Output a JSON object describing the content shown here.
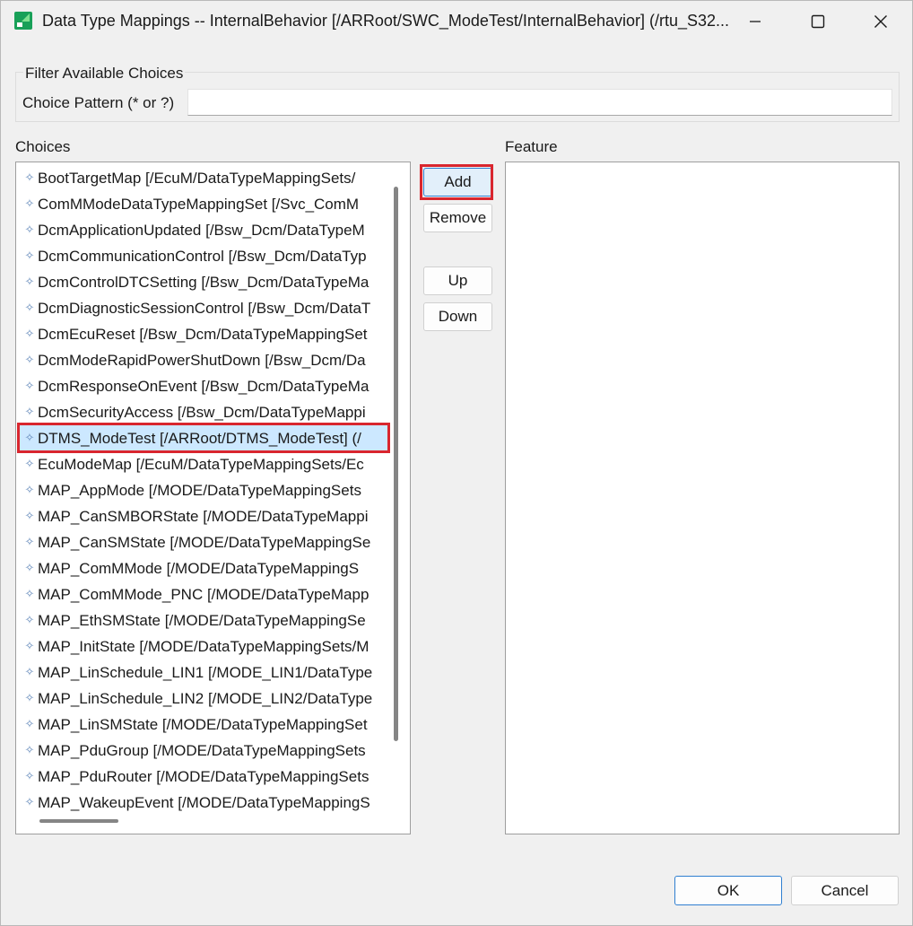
{
  "window": {
    "title": "Data Type Mappings -- InternalBehavior [/ARRoot/SWC_ModeTest/InternalBehavior] (/rtu_S32...",
    "minimize_icon": "minimize-icon",
    "maximize_icon": "maximize-icon",
    "close_icon": "close-icon"
  },
  "filter": {
    "group_label": "Filter Available Choices",
    "pattern_label": "Choice Pattern (* or ?)",
    "pattern_value": ""
  },
  "choices": {
    "label": "Choices",
    "items": [
      {
        "text": "BootTargetMap [/EcuM/DataTypeMappingSets/"
      },
      {
        "text": "ComMModeDataTypeMappingSet [/Svc_ComM"
      },
      {
        "text": "DcmApplicationUpdated [/Bsw_Dcm/DataTypeM"
      },
      {
        "text": "DcmCommunicationControl [/Bsw_Dcm/DataTyp"
      },
      {
        "text": "DcmControlDTCSetting [/Bsw_Dcm/DataTypeMa"
      },
      {
        "text": "DcmDiagnosticSessionControl [/Bsw_Dcm/DataT"
      },
      {
        "text": "DcmEcuReset [/Bsw_Dcm/DataTypeMappingSet"
      },
      {
        "text": "DcmModeRapidPowerShutDown [/Bsw_Dcm/Da"
      },
      {
        "text": "DcmResponseOnEvent [/Bsw_Dcm/DataTypeMa"
      },
      {
        "text": "DcmSecurityAccess [/Bsw_Dcm/DataTypeMappi"
      },
      {
        "text": "DTMS_ModeTest [/ARRoot/DTMS_ModeTest] (/"
      },
      {
        "text": "EcuModeMap [/EcuM/DataTypeMappingSets/Ec"
      },
      {
        "text": "MAP_AppMode [/MODE/DataTypeMappingSets"
      },
      {
        "text": "MAP_CanSMBORState [/MODE/DataTypeMappi"
      },
      {
        "text": "MAP_CanSMState [/MODE/DataTypeMappingSe"
      },
      {
        "text": "MAP_ComMMode [/MODE/DataTypeMappingS"
      },
      {
        "text": "MAP_ComMMode_PNC [/MODE/DataTypeMapp"
      },
      {
        "text": "MAP_EthSMState [/MODE/DataTypeMappingSe"
      },
      {
        "text": "MAP_InitState [/MODE/DataTypeMappingSets/M"
      },
      {
        "text": "MAP_LinSchedule_LIN1 [/MODE_LIN1/DataType"
      },
      {
        "text": "MAP_LinSchedule_LIN2 [/MODE_LIN2/DataType"
      },
      {
        "text": "MAP_LinSMState [/MODE/DataTypeMappingSet"
      },
      {
        "text": "MAP_PduGroup [/MODE/DataTypeMappingSets"
      },
      {
        "text": "MAP_PduRouter [/MODE/DataTypeMappingSets"
      },
      {
        "text": "MAP_WakeupEvent [/MODE/DataTypeMappingS"
      }
    ],
    "selected_index": 10
  },
  "feature": {
    "label": "Feature",
    "items": []
  },
  "buttons": {
    "add": "Add",
    "remove": "Remove",
    "up": "Up",
    "down": "Down",
    "ok": "OK",
    "cancel": "Cancel"
  },
  "icons": {
    "app": "app-icon",
    "list_item": "element-icon"
  },
  "colors": {
    "selection": "#cce8ff",
    "highlight_box": "#d9262e",
    "default_button_border": "#2f7fd0"
  }
}
